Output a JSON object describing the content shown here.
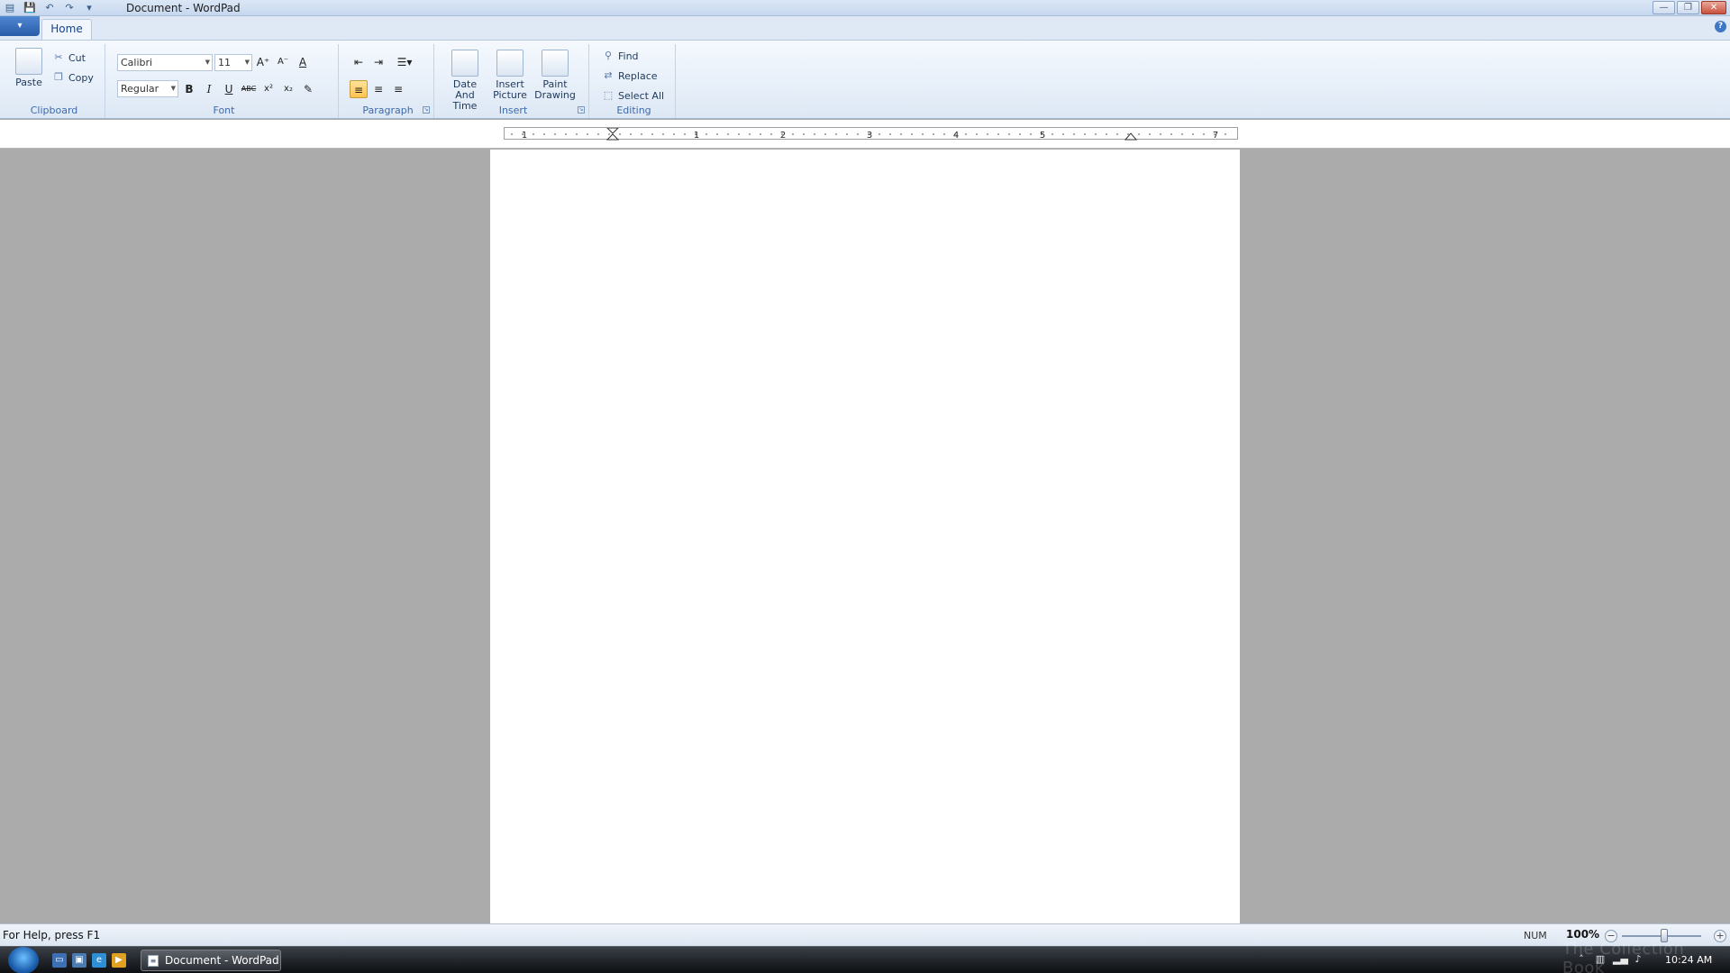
{
  "window": {
    "title": "Document - WordPad",
    "minimize": "—",
    "restore": "❐",
    "close": "✕"
  },
  "qat": {
    "icons": [
      "wordpad-icon",
      "save-icon",
      "undo-icon",
      "redo-icon",
      "customize-qat-icon"
    ]
  },
  "ribbon": {
    "tab_home": "Home",
    "groups": {
      "clipboard": {
        "label": "Clipboard",
        "paste": "Paste",
        "cut": "Cut",
        "copy": "Copy"
      },
      "font": {
        "label": "Font",
        "family": "Calibri",
        "size": "11",
        "style": "Regular",
        "bold": "B",
        "italic": "I",
        "underline": "U",
        "strike": "ABC",
        "superscript": "x²",
        "subscript": "x₂"
      },
      "paragraph": {
        "label": "Paragraph"
      },
      "insert": {
        "label": "Insert",
        "date_time_1": "Date",
        "date_time_2": "And Time",
        "insert_picture_1": "Insert",
        "insert_picture_2": "Picture",
        "paint_drawing_1": "Paint",
        "paint_drawing_2": "Drawing"
      },
      "editing": {
        "label": "Editing",
        "find": "Find",
        "replace": "Replace",
        "select_all": "Select All"
      }
    }
  },
  "ruler": {
    "numbers": [
      "1",
      "1",
      "2",
      "3",
      "4",
      "5",
      "7"
    ]
  },
  "status": {
    "help": "For Help, press F1",
    "num": "NUM",
    "zoom": "100%",
    "zoom_out": "−",
    "zoom_in": "+"
  },
  "taskbar": {
    "task_label": "Document - WordPad",
    "clock": "10:24 AM",
    "watermark": "The Collection Book"
  }
}
